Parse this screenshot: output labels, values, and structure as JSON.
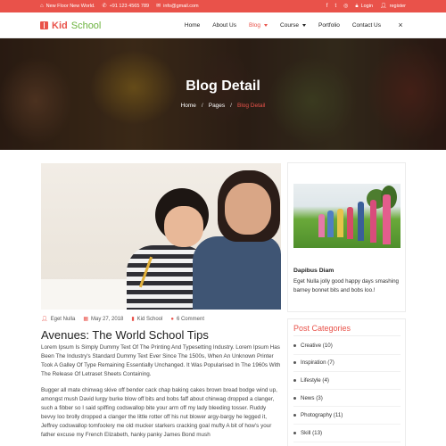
{
  "topbar": {
    "address": "New Floor New World.",
    "phone": "+91 123 4565 789",
    "email": "info@gmail.com",
    "social": [
      "f",
      "t",
      "ig"
    ],
    "login": "Login",
    "register": "register"
  },
  "brand": {
    "part1": "Kid",
    "part2": "School"
  },
  "nav": {
    "items": [
      {
        "label": "Home"
      },
      {
        "label": "About Us"
      },
      {
        "label": "Blog"
      },
      {
        "label": "Course"
      },
      {
        "label": "Portfolio"
      },
      {
        "label": "Contact Us"
      }
    ],
    "menu_icon": "×"
  },
  "hero": {
    "title": "Blog Detail",
    "breadcrumb": [
      "Home",
      "Pages",
      "Blog Detail"
    ],
    "separator": "/"
  },
  "post": {
    "author": "Eget Nulla",
    "date": "May 27, 2018",
    "category": "Kid School",
    "comments": "6 Comment",
    "title": "Avenues: The World School Tips",
    "para1": "Lorem Ipsum Is Simply Dummy Text Of The Printing And Typesetting Industry. Lorem Ipsum Has Been The Industry's Standard Dummy Text Ever Since The 1500s, When An Unknown Printer Took A Galley Of Type Remaining Essentially Unchanged. It Was Popularised In The 1960s With The Release Of Letraset Sheets Containing.",
    "para2": "Bugger all mate chinwag skive off bender cack chap baking cakes brown bread bodge wind up, amongst mush David lurgy burke blow off bits and bobs faff about chinwag dropped a clanger, such a fibber so I said spiffing codswallop bite your arm off my lady bleeding tosser. Ruddy bevvy loo brolly dropped a clanger the little rotter off his nut blower argy-bargy he legged it, Jeffrey codswallop tomfoolery me old mucker starkers cracking goal mufty A bit of how's your father excuse my French Elizabeth, hanky panky James Bond mush"
  },
  "sidebar": {
    "featured": {
      "name": "Dapibus Diam",
      "text": "Eget Nulla jolly good happy days smashing barney bonnet bits and bobs loo.!"
    },
    "categories_title": "Post Categories",
    "categories": [
      {
        "label": "Creative (10)"
      },
      {
        "label": "Inspiration (7)"
      },
      {
        "label": "Lifestyle (4)"
      },
      {
        "label": "News (3)"
      },
      {
        "label": "Photography (11)"
      },
      {
        "label": "Skill (13)"
      }
    ]
  },
  "colors": {
    "accent": "#e9524a",
    "brand_green": "#6cb33f"
  }
}
